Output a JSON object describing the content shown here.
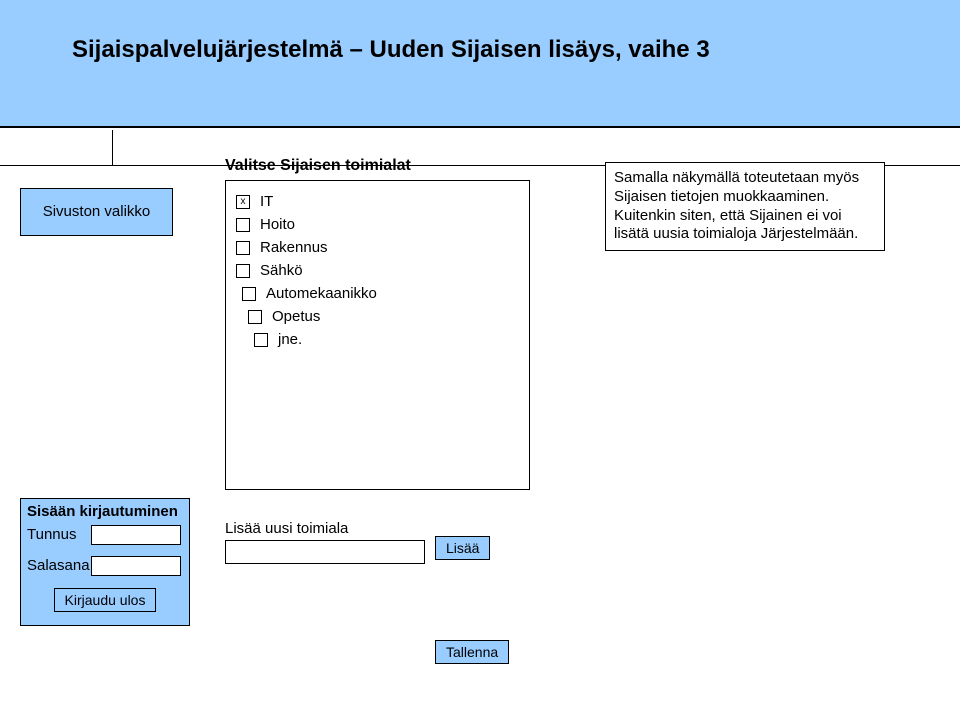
{
  "header": {
    "title": "Sijaispalvelujärjestelmä – Uuden Sijaisen lisäys, vaihe 3"
  },
  "left": {
    "menu_label": "Sivuston valikko",
    "login_title": "Sisään kirjautuminen",
    "username_label": "Tunnus",
    "password_label": "Salasana",
    "logout_label": "Kirjaudu ulos"
  },
  "center": {
    "title": "Valitse Sijaisen toimialat",
    "items": [
      {
        "label": "IT",
        "checked": true,
        "indent": 0
      },
      {
        "label": "Hoito",
        "checked": false,
        "indent": 0
      },
      {
        "label": "Rakennus",
        "checked": false,
        "indent": 0
      },
      {
        "label": "Sähkö",
        "checked": false,
        "indent": 0
      },
      {
        "label": "Automekaanikko",
        "checked": false,
        "indent": 1
      },
      {
        "label": "Opetus",
        "checked": false,
        "indent": 2
      },
      {
        "label": "jne.",
        "checked": false,
        "indent": 3
      }
    ],
    "add_label": "Lisää uusi toimiala",
    "add_button": "Lisää",
    "save_button": "Tallenna"
  },
  "note": {
    "text": "Samalla näkymällä toteutetaan myös Sijaisen tietojen muokkaaminen. Kuitenkin siten, että Sijainen ei voi lisätä uusia toimialoja Järjestelmään."
  }
}
